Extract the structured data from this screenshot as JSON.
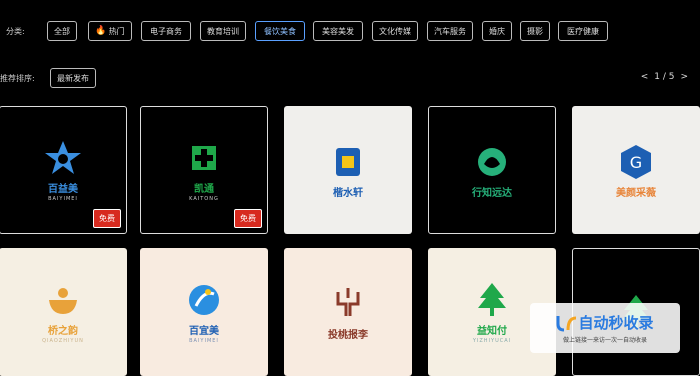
{
  "filter": {
    "label": "分类:",
    "chips": [
      "全部",
      "热门",
      "电子商务",
      "教育培训",
      "餐饮美食",
      "美容美发",
      "文化传媒",
      "汽车服务",
      "婚庆",
      "摄影",
      "医疗健康"
    ],
    "hot_chip_index": 1,
    "active_chip_index": 4
  },
  "subfilter": {
    "label": "推荐排序:",
    "chip": "最新发布"
  },
  "pager": {
    "prev": "<",
    "text": "1 / 5",
    "next": ">"
  },
  "cards": [
    {
      "brand": "百益美",
      "sub": "BAIYIMEI",
      "free": "免费",
      "style": "dark",
      "brand_color": "#3a8fe0",
      "icon": "star-logo-icon"
    },
    {
      "brand": "凯通",
      "sub": "KAITONG",
      "free": "免费",
      "style": "dark",
      "brand_color": "#1fa84a",
      "icon": "cross-logo-icon"
    },
    {
      "brand": "楷水轩",
      "sub": "",
      "free": "",
      "style": "light",
      "brand_color": "#1d5fb3",
      "icon": "square-logo-icon"
    },
    {
      "brand": "行知远达",
      "sub": "",
      "free": "",
      "style": "dark",
      "brand_color": "#26b07a",
      "icon": "leaf-logo-icon"
    },
    {
      "brand": "美颜采薇",
      "sub": "",
      "free": "",
      "style": "light",
      "brand_color": "#e8853a",
      "icon": "hexagon-logo-icon"
    },
    {
      "brand": "桥之韵",
      "sub": "QIAOZHIYUN",
      "free": "",
      "style": "cream",
      "brand_color": "#e8a23a",
      "icon": "bowl-logo-icon"
    },
    {
      "brand": "百宜美",
      "sub": "BAIYIMEI",
      "free": "",
      "style": "peach",
      "brand_color": "#1d5fb3",
      "icon": "runner-logo-icon"
    },
    {
      "brand": "投桃报李",
      "sub": "",
      "free": "",
      "style": "peach",
      "brand_color": "#8a3a2a",
      "icon": "branch-logo-icon"
    },
    {
      "brand": "益知付",
      "sub": "YIZHIYUCAI",
      "free": "",
      "style": "cream",
      "brand_color": "#1fa84a",
      "icon": "tree-logo-icon"
    },
    {
      "brand": "",
      "sub": "",
      "free": "",
      "style": "dark",
      "brand_color": "#1fa84a",
      "icon": "tree-logo-icon"
    }
  ],
  "watermark": {
    "main": "自动秒收录",
    "sub": "做上链接一来访一次一自动收录"
  }
}
